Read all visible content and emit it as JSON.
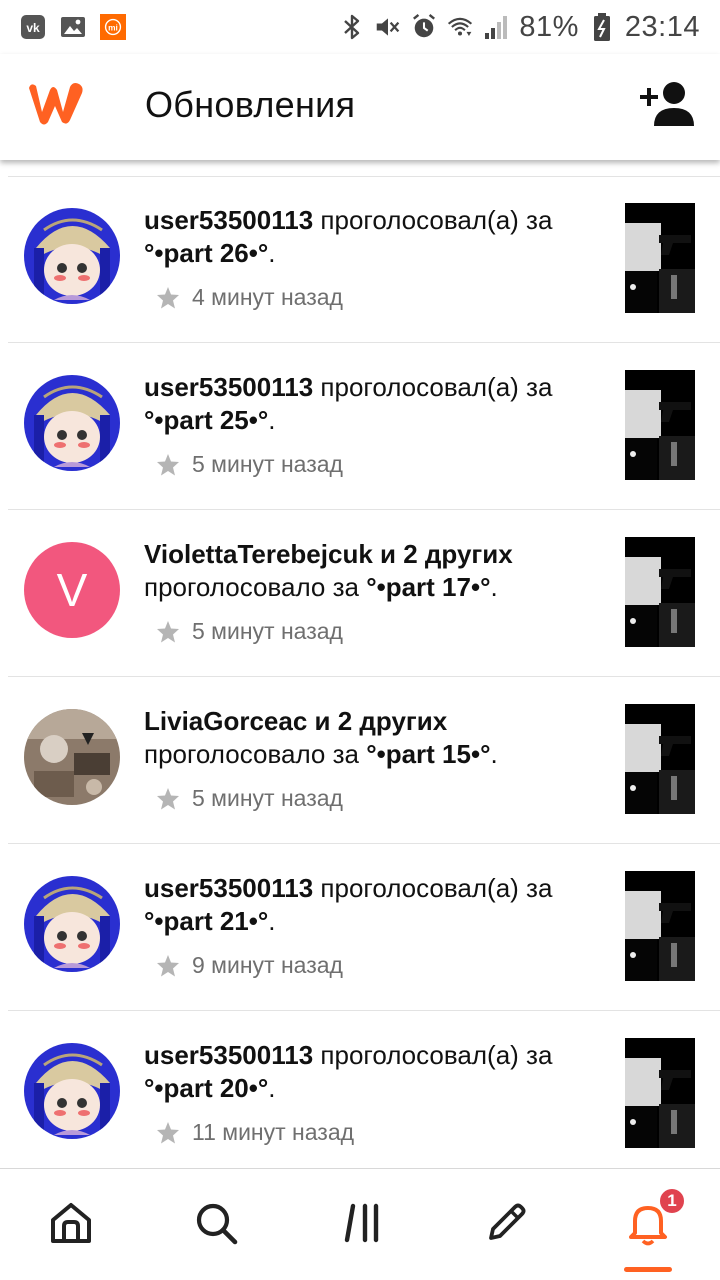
{
  "status_bar": {
    "battery": "81%",
    "time": "23:14",
    "notification_icons": [
      "vk-icon",
      "gallery-icon",
      "mi-icon"
    ],
    "system_icons": [
      "bluetooth-icon",
      "mute-icon",
      "alarm-icon",
      "wifi-icon",
      "signal-icon",
      "battery-icon"
    ]
  },
  "app_bar": {
    "title": "Обновления",
    "brand_color": "#ff6122"
  },
  "notifications": [
    {
      "user": "user53500113",
      "action": "проголосовал(а) за",
      "story": "°•part 26•°",
      "time": "4 минут назад",
      "avatar": "anime"
    },
    {
      "user": "user53500113",
      "action": "проголосовал(а) за",
      "story": "°•part 25•°",
      "time": "5 минут назад",
      "avatar": "anime"
    },
    {
      "user": "ViolettaTerebejcuk и 2 других",
      "action": "проголосовало за",
      "story": "°•part 17•°",
      "time": "5 минут назад",
      "avatar": "letter",
      "letter": "V"
    },
    {
      "user": "LiviaGorceac и 2 других",
      "action": "проголосовало за",
      "story": "°•part 15•°",
      "time": "5 минут назад",
      "avatar": "photo"
    },
    {
      "user": "user53500113",
      "action": "проголосовал(а) за",
      "story": "°•part 21•°",
      "time": "9 минут назад",
      "avatar": "anime"
    },
    {
      "user": "user53500113",
      "action": "проголосовал(а) за",
      "story": "°•part 20•°",
      "time": "11 минут назад",
      "avatar": "anime"
    }
  ],
  "bottom_nav": {
    "items": [
      "home-icon",
      "search-icon",
      "library-icon",
      "write-icon",
      "notifications-icon"
    ],
    "active": "notifications-icon",
    "notification_badge": "1"
  }
}
